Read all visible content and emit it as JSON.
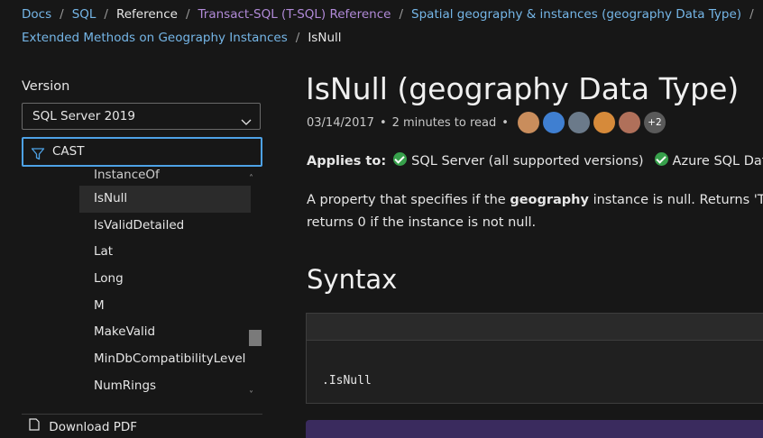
{
  "breadcrumb": {
    "row1": [
      {
        "label": "Docs",
        "type": "link"
      },
      {
        "label": "SQL",
        "type": "link"
      },
      {
        "label": "Reference",
        "type": "current"
      },
      {
        "label": "Transact-SQL (T-SQL) Reference",
        "type": "visited"
      },
      {
        "label": "Spatial geography & instances (geography Data Type)",
        "type": "link"
      }
    ],
    "row2": [
      {
        "label": "Extended Methods on Geography Instances",
        "type": "link"
      },
      {
        "label": "IsNull",
        "type": "current"
      }
    ],
    "separator": "/"
  },
  "sidebar": {
    "version_label": "Version",
    "version_value": "SQL Server 2019",
    "filter_value": "CAST",
    "toc_items": [
      {
        "label": "InstanceOf",
        "state": "clipped"
      },
      {
        "label": "IsNull",
        "state": "active"
      },
      {
        "label": "IsValidDetailed",
        "state": ""
      },
      {
        "label": "Lat",
        "state": ""
      },
      {
        "label": "Long",
        "state": ""
      },
      {
        "label": "M",
        "state": ""
      },
      {
        "label": "MakeValid",
        "state": ""
      },
      {
        "label": "MinDbCompatibilityLevel",
        "state": ""
      },
      {
        "label": "NumRings",
        "state": ""
      }
    ],
    "download_label": "Download PDF"
  },
  "article": {
    "title": "IsNull (geography Data Type)",
    "date": "03/14/2017",
    "read_time": "2 minutes to read",
    "meta_separator": "•",
    "contributors_more": "+2",
    "applies_label": "Applies to:",
    "applies": [
      "SQL Server (all supported versions)",
      "Azure SQL Datab"
    ],
    "description_prefix": "A property that specifies if the ",
    "description_bold": "geography",
    "description_suffix": " instance is null. Returns 'TRUE",
    "description_line2": "returns 0 if the instance is not null.",
    "syntax_heading": "Syntax",
    "code": ".IsNull"
  },
  "colors": {
    "link": "#75b6e7",
    "visited": "#b18ad8",
    "focus_border": "#4ea2e6",
    "check": "#37a04b",
    "avatars": [
      "#c98d5c",
      "#3f7fd1",
      "#6b7a8a",
      "#d68a3a",
      "#b0705a"
    ]
  }
}
